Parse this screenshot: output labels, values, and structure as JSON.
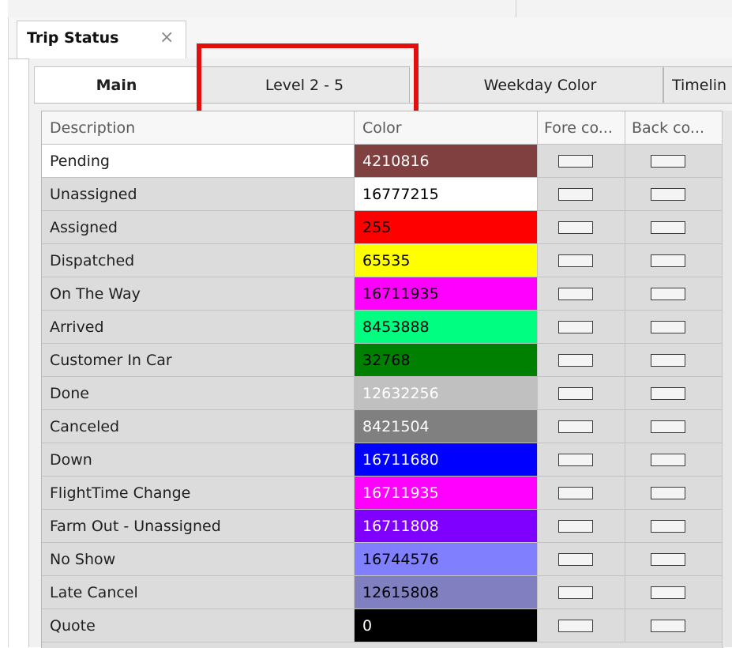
{
  "document_tab": {
    "title": "Trip Status",
    "close_glyph": "×"
  },
  "tabs": [
    {
      "id": "main",
      "label": "Main",
      "active": true
    },
    {
      "id": "level",
      "label": "Level 2 - 5",
      "active": false,
      "highlighted": true
    },
    {
      "id": "weekday",
      "label": "Weekday Color",
      "active": false
    },
    {
      "id": "timeline",
      "label": "Timelin",
      "active": false
    }
  ],
  "grid": {
    "columns": {
      "description": "Description",
      "color": "Color",
      "fore": "Fore co...",
      "back": "Back co..."
    },
    "rows": [
      {
        "description": "Pending",
        "color": "4210816",
        "bg": "#804040",
        "fg": "#ffffff",
        "selected": true
      },
      {
        "description": "Unassigned",
        "color": "16777215",
        "bg": "#ffffff",
        "fg": "#000000"
      },
      {
        "description": "Assigned",
        "color": "255",
        "bg": "#ff0000",
        "fg": "#000000"
      },
      {
        "description": "Dispatched",
        "color": "65535",
        "bg": "#ffff00",
        "fg": "#000000"
      },
      {
        "description": "On The Way",
        "color": "16711935",
        "bg": "#ff00ff",
        "fg": "#000000"
      },
      {
        "description": "Arrived",
        "color": "8453888",
        "bg": "#00ff80",
        "fg": "#000000"
      },
      {
        "description": "Customer In Car",
        "color": "32768",
        "bg": "#008000",
        "fg": "#000000"
      },
      {
        "description": "Done",
        "color": "12632256",
        "bg": "#c0c0c0",
        "fg": "#ffffff"
      },
      {
        "description": "Canceled",
        "color": "8421504",
        "bg": "#808080",
        "fg": "#ffffff"
      },
      {
        "description": "Down",
        "color": "16711680",
        "bg": "#0000ff",
        "fg": "#ffffff"
      },
      {
        "description": "FlightTime Change",
        "color": "16711935",
        "bg": "#ff00ff",
        "fg": "#ffffff"
      },
      {
        "description": "Farm Out - Unassigned",
        "color": "16711808",
        "bg": "#8000ff",
        "fg": "#ffffff"
      },
      {
        "description": "No Show",
        "color": "16744576",
        "bg": "#8080ff",
        "fg": "#000000"
      },
      {
        "description": "Late Cancel",
        "color": "12615808",
        "bg": "#8080c0",
        "fg": "#000000"
      },
      {
        "description": "Quote",
        "color": "0",
        "bg": "#000000",
        "fg": "#ffffff"
      }
    ]
  },
  "colors": {
    "highlight_border": "#e01010",
    "grid_cell_bg": "#dcdcdc",
    "selected_row_bg": "#ffffff"
  },
  "icons": {
    "close": "close-icon",
    "fore_swatch": "color-swatch-icon",
    "back_swatch": "color-swatch-icon"
  }
}
